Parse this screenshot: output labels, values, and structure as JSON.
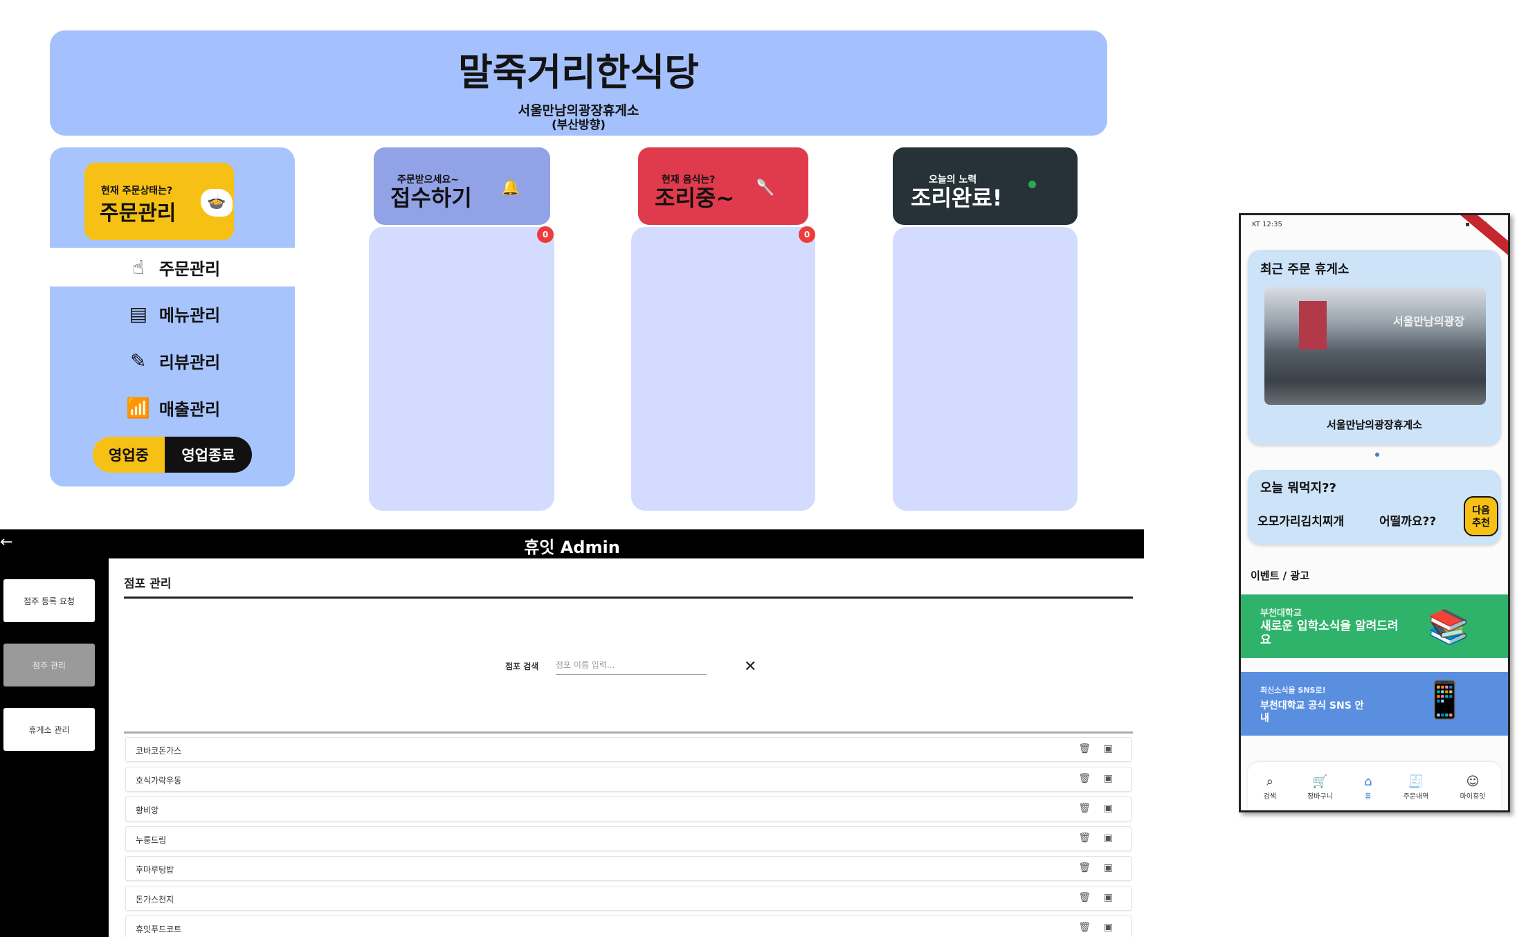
{
  "restaurant": {
    "title": "말죽거리한식당",
    "subtitle": "서울만남의광장휴게소",
    "direction": "(부산방향)"
  },
  "sidebar": {
    "status_question": "현재 주문상태는?",
    "status_title": "주문관리",
    "items": [
      {
        "label": "주문관리",
        "icon": "order-icon"
      },
      {
        "label": "메뉴관리",
        "icon": "menu-icon"
      },
      {
        "label": "리뷰관리",
        "icon": "review-icon"
      },
      {
        "label": "매출관리",
        "icon": "sales-chart-icon"
      }
    ],
    "toggle_open": "영업중",
    "toggle_close": "영업종료"
  },
  "columns": [
    {
      "small": "주문받으세요~",
      "big": "접수하기",
      "icon": "bell-icon",
      "count": "0",
      "color": "#92a2e6"
    },
    {
      "small": "현재 음식는?",
      "big": "조리중~",
      "icon": "pot-icon",
      "count": "0",
      "color": "#e03b4c"
    },
    {
      "small": "오늘의 노력",
      "big": "조리완료!",
      "icon": "green-dot-icon",
      "color": "#263238"
    }
  ],
  "admin": {
    "back": "←",
    "title": "휴잇 Admin",
    "side_buttons": [
      "점주 등록 요청",
      "점주 관리",
      "휴게소 관리"
    ],
    "section_title": "점포 관리",
    "search_label": "점포 검색",
    "search_placeholder": "점포 이름 입력...",
    "clear": "✕",
    "stores": [
      "코바코돈가스",
      "호식가락우동",
      "황비앙",
      "누룽드림",
      "후마루텅밥",
      "돈가스천지",
      "휴잇푸드코트"
    ],
    "delete_glyph": "🗑",
    "image_glyph": "▣"
  },
  "phone": {
    "status_left": "KT 12:35",
    "status_right": "▪ ◂ ▸ ▮",
    "recent_title": "최근 주문 휴게소",
    "photo_sign": "서울만남의광장",
    "recent_name": "서울만남의광장휴게소",
    "today_title": "오늘 뭐먹지??",
    "today_menu": "오모가리김치찌개",
    "today_question": "어떨까요??",
    "recommend_label": "다음\n추천",
    "events_title": "이벤트 / 광고",
    "banner1_small": "부천대학교",
    "banner1_big": "새로운 입학소식을 알려드려요",
    "banner2_small": "최신소식을 SNS로!",
    "banner2_big": "부천대학교 공식 SNS 안내",
    "tabs": [
      {
        "label": "검색",
        "icon": "search-icon"
      },
      {
        "label": "장바구니",
        "icon": "cart-icon"
      },
      {
        "label": "홈",
        "icon": "home-icon"
      },
      {
        "label": "주문내역",
        "icon": "receipt-icon"
      },
      {
        "label": "마이휴잇",
        "icon": "profile-icon"
      }
    ]
  },
  "colors": {
    "header": "#a5c1fd",
    "sidebar": "#a7c4fd",
    "column_body": "#d3dcfe",
    "yellow": "#f6c114",
    "badge": "#ee3b3b",
    "phone_card": "#cde3f8",
    "banner_green": "#2fb36b",
    "banner_blue": "#5a8fe0"
  }
}
